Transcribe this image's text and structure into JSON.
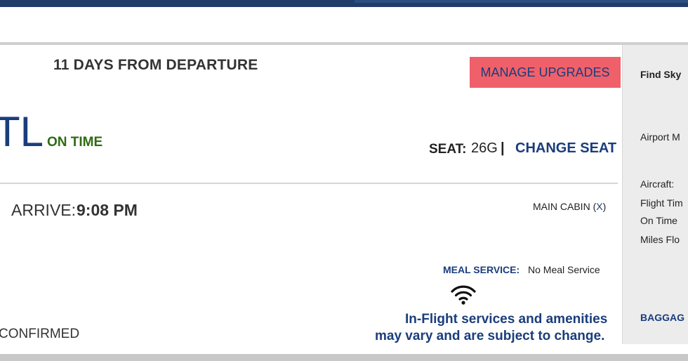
{
  "trip": {
    "days_to_departure": "11 DAYS FROM DEPARTURE",
    "manage_upgrades_label": "MANAGE UPGRADES",
    "airport_code_partial": "TL",
    "flight_status": "ON TIME",
    "seat_label": "SEAT:",
    "seat_value": "26G",
    "seat_separator": "|",
    "change_seat_label": "CHANGE SEAT",
    "arrive_label": "ARRIVE:",
    "arrive_time": "9:08 PM",
    "cabin_label": "MAIN CABIN (",
    "cabin_close": "X",
    "cabin_label_end": ")",
    "meal_label": "MEAL SERVICE:",
    "meal_value": "No Meal Service",
    "inflight_line1": "In-Flight services and amenities",
    "inflight_line2": "may vary and are subject to change.",
    "status_partial": "CONFIRMED"
  },
  "sidebar": {
    "find_sky": "Find Sky",
    "airport_map": "Airport M",
    "aircraft": "Aircraft:",
    "flight_time": "Flight Tim",
    "on_time": "On Time",
    "miles_flown": "Miles Flo",
    "baggage": "BAGGAG"
  },
  "colors": {
    "brand_navy": "#1a3d7c",
    "upgrade_button": "#f0606a",
    "on_time_green": "#2e6b12"
  },
  "icons": {
    "wifi": "wifi-icon"
  }
}
